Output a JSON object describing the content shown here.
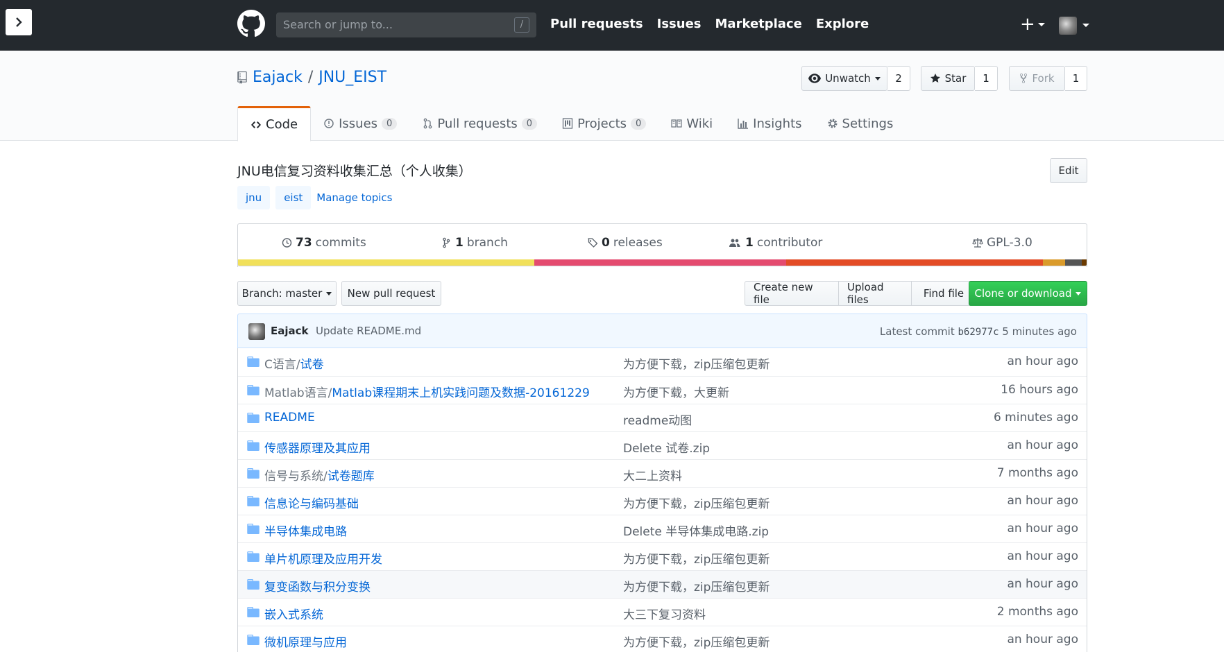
{
  "header": {
    "search_placeholder": "Search or jump to...",
    "search_shortcut": "/",
    "nav": [
      "Pull requests",
      "Issues",
      "Marketplace",
      "Explore"
    ],
    "plus": "+"
  },
  "repo": {
    "owner": "Eajack",
    "separator": "/",
    "name": "JNU_EIST",
    "unwatch_label": "Unwatch",
    "watch_count": "2",
    "star_label": "Star",
    "star_count": "1",
    "fork_label": "Fork",
    "fork_count": "1"
  },
  "tabs": [
    {
      "label": "Code"
    },
    {
      "label": "Issues",
      "count": "0"
    },
    {
      "label": "Pull requests",
      "count": "0"
    },
    {
      "label": "Projects",
      "count": "0"
    },
    {
      "label": "Wiki"
    },
    {
      "label": "Insights"
    },
    {
      "label": "Settings"
    }
  ],
  "description": "JNU电信复习资料收集汇总（个人收集）",
  "edit_label": "Edit",
  "topics": [
    "jnu",
    "eist"
  ],
  "manage_topics": "Manage topics",
  "summary": {
    "commits_num": "73",
    "commits_label": "commits",
    "branch_num": "1",
    "branch_label": "branch",
    "releases_num": "0",
    "releases_label": "releases",
    "contributor_num": "1",
    "contributor_label": "contributor",
    "license": "GPL-3.0"
  },
  "language_bar": [
    {
      "color": "#f1e05a",
      "fraction": 0.354
    },
    {
      "color": "#e44b6f",
      "fraction": 0.3
    },
    {
      "color": "#e34c26",
      "fraction": 0.307
    },
    {
      "color": "#da9b2b",
      "fraction": 0.026
    },
    {
      "color": "#555555",
      "fraction": 0.02
    },
    {
      "color": "#6b3a00",
      "fraction": 0.006
    }
  ],
  "file_nav": {
    "branch_label": "Branch: master",
    "new_pr": "New pull request",
    "create_file": "Create new file",
    "upload_files": "Upload files",
    "find_file": "Find file",
    "clone": "Clone or download"
  },
  "commit_tease": {
    "author": "Eajack",
    "message": "Update README.md",
    "latest_label": "Latest commit",
    "sha": "b62977c",
    "age": "5 minutes ago"
  },
  "files": [
    {
      "prefix": "C语言/",
      "name": "试卷",
      "message": "为方便下载，zip压缩包更新",
      "age": "an hour ago"
    },
    {
      "prefix": "Matlab语言/",
      "name": "Matlab课程期末上机实践问题及数据-20161229",
      "message": "为方便下载，大更新",
      "age": "16 hours ago"
    },
    {
      "prefix": "",
      "name": "README",
      "message": "readme动图",
      "age": "6 minutes ago"
    },
    {
      "prefix": "",
      "name": "传感器原理及其应用",
      "message": "Delete 试卷.zip",
      "age": "an hour ago"
    },
    {
      "prefix": "信号与系统/",
      "name": "试卷题库",
      "message": "大二上资料",
      "age": "7 months ago"
    },
    {
      "prefix": "",
      "name": "信息论与编码基础",
      "message": "为方便下载，zip压缩包更新",
      "age": "an hour ago"
    },
    {
      "prefix": "",
      "name": "半导体集成电路",
      "message": "Delete 半导体集成电路.zip",
      "age": "an hour ago"
    },
    {
      "prefix": "",
      "name": "单片机原理及应用开发",
      "message": "为方便下载，zip压缩包更新",
      "age": "an hour ago"
    },
    {
      "prefix": "",
      "name": "复变函数与积分变换",
      "message": "为方便下载，zip压缩包更新",
      "age": "an hour ago"
    },
    {
      "prefix": "",
      "name": "嵌入式系统",
      "message": "大三下复习资料",
      "age": "2 months ago"
    },
    {
      "prefix": "",
      "name": "微机原理与应用",
      "message": "为方便下载，zip压缩包更新",
      "age": "an hour ago"
    }
  ]
}
